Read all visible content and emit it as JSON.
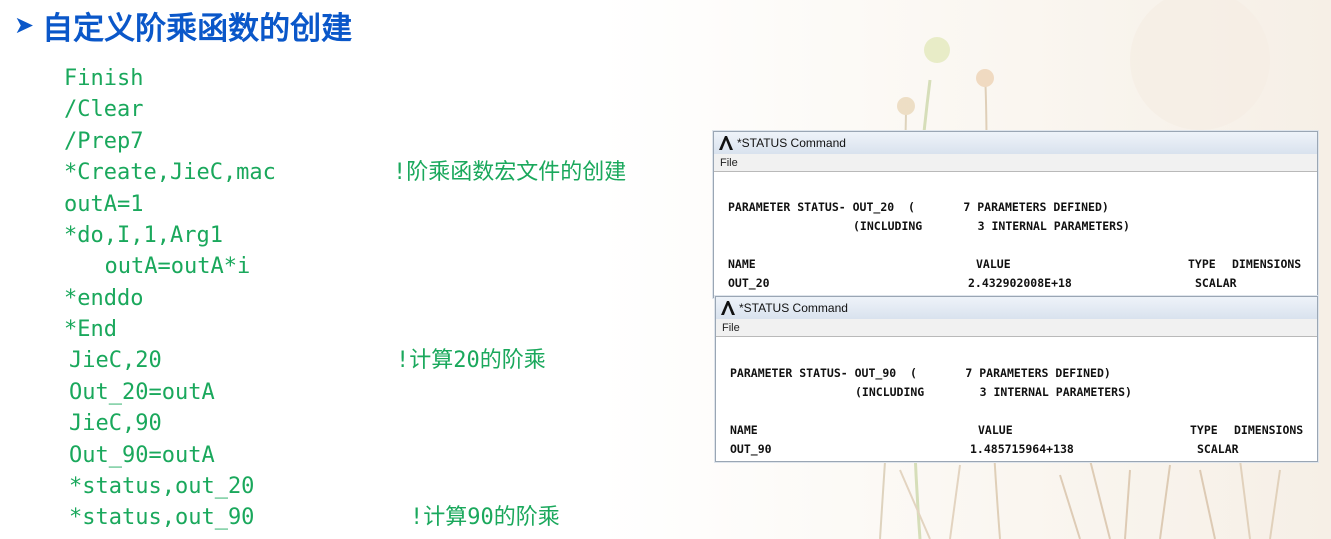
{
  "slide": {
    "title": "自定义阶乘函数的创建",
    "code_lines": [
      "Finish",
      "/Clear",
      "/Prep7",
      "*Create,JieC,mac",
      "outA=1",
      "*do,I,1,Arg1",
      "  outA=outA*i",
      "*enddo",
      "*End",
      "JieC,20",
      "Out_20=outA",
      "JieC,90",
      "Out_90=outA",
      "*status,out_20",
      "*status,out_90"
    ],
    "comments": {
      "create": "!阶乘函数宏文件的创建",
      "calc20": "!计算20的阶乘",
      "calc90": "!计算90的阶乘"
    }
  },
  "windows": [
    {
      "title": "*STATUS Command",
      "menu": "File",
      "status_line": "PARAMETER STATUS- OUT_20  (       7 PARAMETERS DEFINED)",
      "including_line": "(INCLUDING        3 INTERNAL PARAMETERS)",
      "headers": {
        "name": "NAME",
        "value": "VALUE",
        "type": "TYPE",
        "dimensions": "DIMENSIONS"
      },
      "row": {
        "name": "OUT_20",
        "value": "2.432902008E+18",
        "type": "SCALAR"
      }
    },
    {
      "title": "*STATUS Command",
      "menu": "File",
      "status_line": "PARAMETER STATUS- OUT_90  (       7 PARAMETERS DEFINED)",
      "including_line": "(INCLUDING        3 INTERNAL PARAMETERS)",
      "headers": {
        "name": "NAME",
        "value": "VALUE",
        "type": "TYPE",
        "dimensions": "DIMENSIONS"
      },
      "row": {
        "name": "OUT_90",
        "value": "1.485715964+138",
        "type": "SCALAR"
      }
    }
  ],
  "icons": {
    "title_bullet": "arrow-bullet-icon",
    "window_logo": "ansys-logo-icon"
  },
  "colors": {
    "title": "#0a57c9",
    "code": "#1aa85c"
  }
}
